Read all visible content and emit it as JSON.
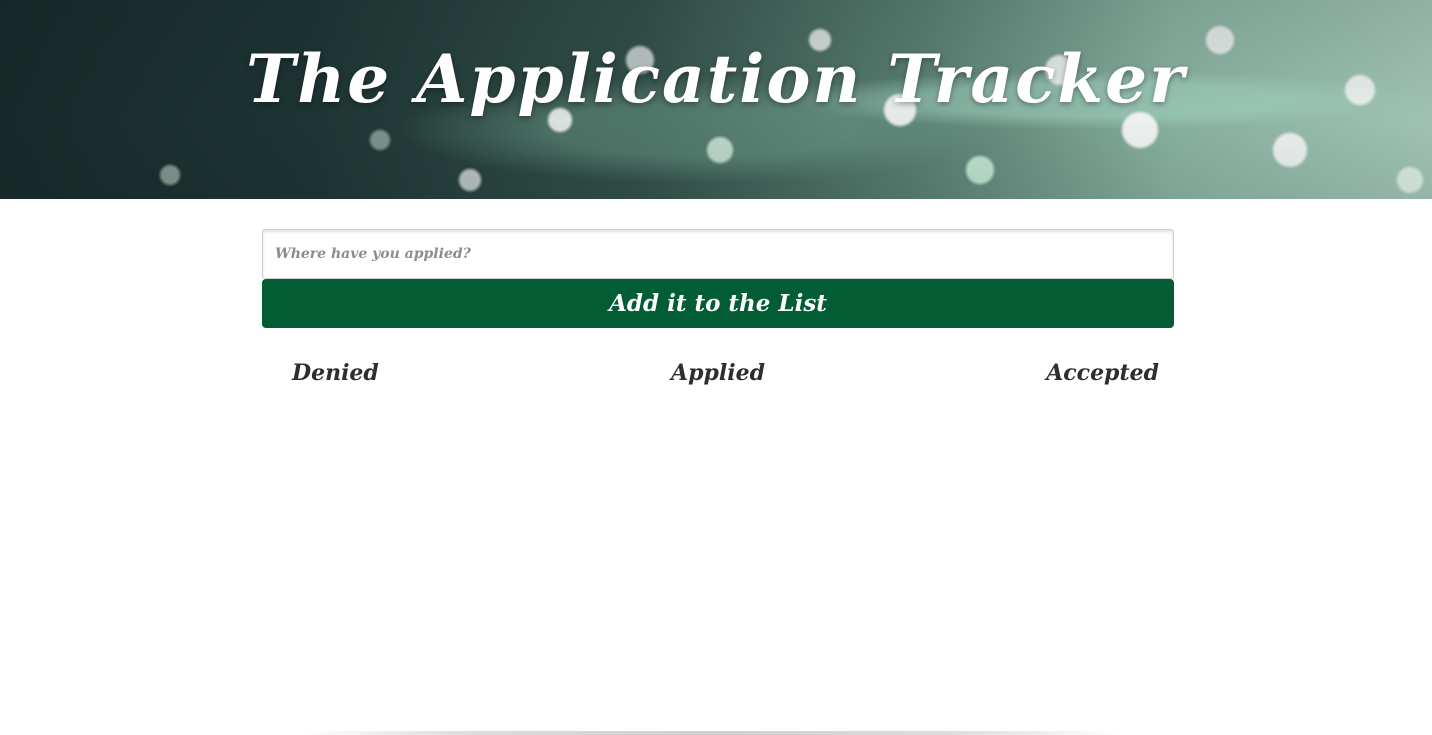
{
  "header": {
    "title": "The Application Tracker"
  },
  "form": {
    "input_placeholder": "Where have you applied?",
    "input_value": "",
    "submit_label": "Add it to the List"
  },
  "columns": {
    "denied": "Denied",
    "applied": "Applied",
    "accepted": "Accepted"
  },
  "colors": {
    "primary_button": "#025c34",
    "heading_text": "#2e2e2e"
  }
}
